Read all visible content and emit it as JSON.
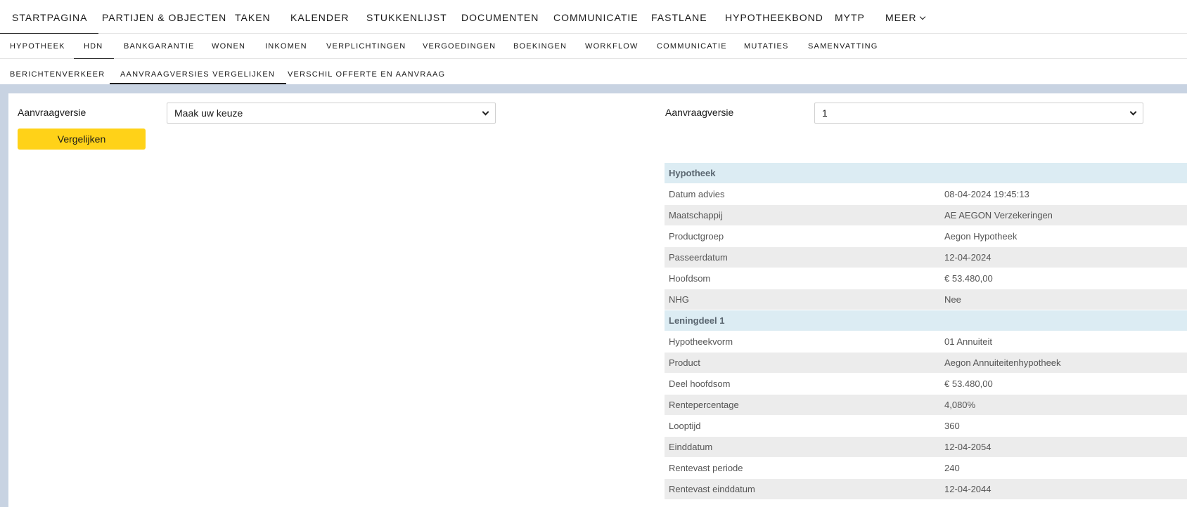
{
  "nav_primary": {
    "items": [
      {
        "label": "STARTPAGINA",
        "active": true
      },
      {
        "label": "PARTIJEN & OBJECTEN"
      },
      {
        "label": "TAKEN"
      },
      {
        "label": "KALENDER"
      },
      {
        "label": "STUKKENLIJST"
      },
      {
        "label": "DOCUMENTEN"
      },
      {
        "label": "COMMUNICATIE"
      },
      {
        "label": "FASTLANE"
      },
      {
        "label": "HYPOTHEEKBOND"
      },
      {
        "label": "MYTP"
      },
      {
        "label": "MEER"
      }
    ]
  },
  "nav_secondary": {
    "items": [
      {
        "label": "HYPOTHEEK"
      },
      {
        "label": "HDN",
        "active": true
      },
      {
        "label": "BANKGARANTIE"
      },
      {
        "label": "WONEN"
      },
      {
        "label": "INKOMEN"
      },
      {
        "label": "VERPLICHTINGEN"
      },
      {
        "label": "VERGOEDINGEN"
      },
      {
        "label": "BOEKINGEN"
      },
      {
        "label": "WORKFLOW"
      },
      {
        "label": "COMMUNICATIE"
      },
      {
        "label": "MUTATIES"
      },
      {
        "label": "SAMENVATTING"
      }
    ]
  },
  "nav_tertiary": {
    "items": [
      {
        "label": "BERICHTENVERKEER"
      },
      {
        "label": "AANVRAAGVERSIES VERGELIJKEN",
        "active": true
      },
      {
        "label": "VERSCHIL OFFERTE EN AANVRAAG"
      }
    ]
  },
  "compare": {
    "left_label": "Aanvraagversie",
    "left_select_value": "Maak uw keuze",
    "right_label": "Aanvraagversie",
    "right_select_value": "1",
    "compare_button": "Vergelijken"
  },
  "details": {
    "rows": [
      {
        "type": "header",
        "key": "Hypotheek",
        "value": ""
      },
      {
        "key": "Datum advies",
        "value": "08-04-2024 19:45:13"
      },
      {
        "key": "Maatschappij",
        "value": "AE AEGON Verzekeringen"
      },
      {
        "key": "Productgroep",
        "value": "Aegon Hypotheek"
      },
      {
        "key": "Passeerdatum",
        "value": "12-04-2024"
      },
      {
        "key": "Hoofdsom",
        "value": "€ 53.480,00"
      },
      {
        "key": "NHG",
        "value": "Nee"
      },
      {
        "type": "header",
        "key": "Leningdeel 1",
        "value": ""
      },
      {
        "key": "Hypotheekvorm",
        "value": "01 Annuiteit"
      },
      {
        "key": "Product",
        "value": "Aegon Annuiteitenhypotheek"
      },
      {
        "key": "Deel hoofdsom",
        "value": "€ 53.480,00"
      },
      {
        "key": "Rentepercentage",
        "value": "4,080%"
      },
      {
        "key": "Looptijd",
        "value": "360"
      },
      {
        "key": "Einddatum",
        "value": "12-04-2054"
      },
      {
        "key": "Rentevast periode",
        "value": "240"
      },
      {
        "key": "Rentevast einddatum",
        "value": "12-04-2044"
      }
    ]
  }
}
